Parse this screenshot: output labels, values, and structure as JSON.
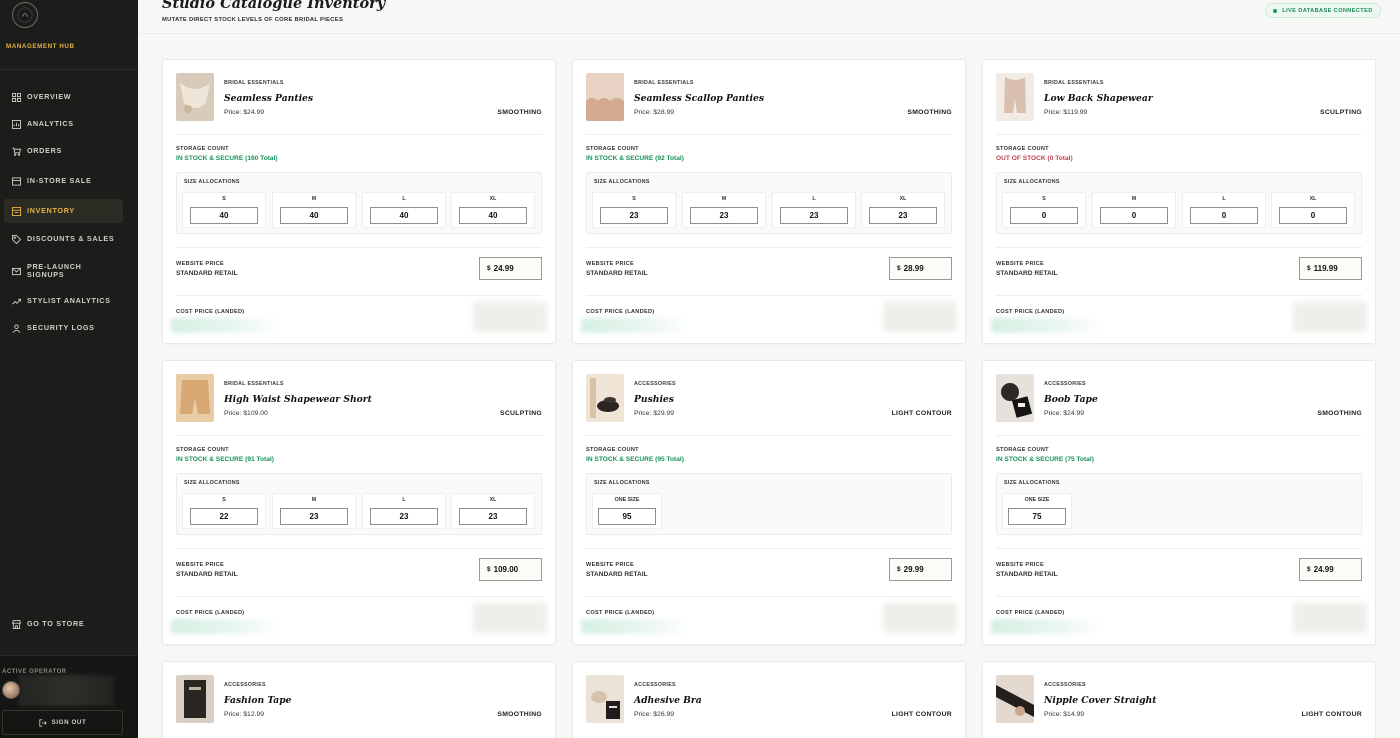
{
  "sidebar": {
    "hub_label": "MANAGEMENT HUB",
    "nav": [
      {
        "label": "OVERVIEW",
        "icon": "grid-icon"
      },
      {
        "label": "ANALYTICS",
        "icon": "chart-icon"
      },
      {
        "label": "ORDERS",
        "icon": "cart-icon"
      },
      {
        "label": "IN-STORE SALE",
        "icon": "register-icon"
      },
      {
        "label": "INVENTORY",
        "icon": "box-icon",
        "active": true
      },
      {
        "label": "DISCOUNTS & SALES",
        "icon": "tag-icon"
      },
      {
        "label": "PRE-LAUNCH SIGNUPS",
        "icon": "mail-icon"
      },
      {
        "label": "STYLIST ANALYTICS",
        "icon": "trend-icon"
      },
      {
        "label": "SECURITY LOGS",
        "icon": "shield-user-icon"
      }
    ],
    "go_to_store": "GO TO STORE",
    "operator_label": "ACTIVE OPERATOR",
    "sign_out": "SIGN OUT"
  },
  "header": {
    "title": "Studio Catalogue Inventory",
    "subtitle": "MUTATE DIRECT STOCK LEVELS OF CORE BRIDAL PIECES",
    "status": "LIVE DATABASE CONNECTED"
  },
  "labels": {
    "storage_count": "STORAGE COUNT",
    "size_allocations": "SIZE ALLOCATIONS",
    "website_price": "WEBSITE PRICE",
    "standard_retail": "STANDARD RETAIL",
    "cost_price": "COST PRICE (LANDED)",
    "currency": "$"
  },
  "colors": {
    "accent": "#e2b344",
    "in_stock": "#17925a",
    "out_of_stock": "#c0444f",
    "sidebar_bg": "#1c1c1a"
  },
  "products": [
    {
      "category": "BRIDAL ESSENTIALS",
      "name": "Seamless Panties",
      "price": "Price: $24.99",
      "tag": "SMOOTHING",
      "stock": "IN STOCK & SECURE (160 Total)",
      "in_stock": true,
      "sizes": [
        {
          "size": "S",
          "qty": "40"
        },
        {
          "size": "M",
          "qty": "40"
        },
        {
          "size": "L",
          "qty": "40"
        },
        {
          "size": "XL",
          "qty": "40"
        }
      ],
      "web_price": "24.99"
    },
    {
      "category": "BRIDAL ESSENTIALS",
      "name": "Seamless Scallop Panties",
      "price": "Price: $28.99",
      "tag": "SMOOTHING",
      "stock": "IN STOCK & SECURE (92 Total)",
      "in_stock": true,
      "sizes": [
        {
          "size": "S",
          "qty": "23"
        },
        {
          "size": "M",
          "qty": "23"
        },
        {
          "size": "L",
          "qty": "23"
        },
        {
          "size": "XL",
          "qty": "23"
        }
      ],
      "web_price": "28.99"
    },
    {
      "category": "BRIDAL ESSENTIALS",
      "name": "Low Back Shapewear",
      "price": "Price: $119.99",
      "tag": "SCULPTING",
      "stock": "OUT OF STOCK (0 Total)",
      "in_stock": false,
      "sizes": [
        {
          "size": "S",
          "qty": "0"
        },
        {
          "size": "M",
          "qty": "0"
        },
        {
          "size": "L",
          "qty": "0"
        },
        {
          "size": "XL",
          "qty": "0"
        }
      ],
      "web_price": "119.99"
    },
    {
      "category": "BRIDAL ESSENTIALS",
      "name": "High Waist Shapewear Short",
      "price": "Price: $109.00",
      "tag": "SCULPTING",
      "stock": "IN STOCK & SECURE (91 Total)",
      "in_stock": true,
      "sizes": [
        {
          "size": "S",
          "qty": "22"
        },
        {
          "size": "M",
          "qty": "23"
        },
        {
          "size": "L",
          "qty": "23"
        },
        {
          "size": "XL",
          "qty": "23"
        }
      ],
      "web_price": "109.00"
    },
    {
      "category": "ACCESSORIES",
      "name": "Pushies",
      "price": "Price: $29.99",
      "tag": "LIGHT CONTOUR",
      "stock": "IN STOCK & SECURE (95 Total)",
      "in_stock": true,
      "sizes": [
        {
          "size": "ONE SIZE",
          "qty": "95"
        }
      ],
      "web_price": "29.99"
    },
    {
      "category": "ACCESSORIES",
      "name": "Boob Tape",
      "price": "Price: $24.99",
      "tag": "SMOOTHING",
      "stock": "IN STOCK & SECURE (75 Total)",
      "in_stock": true,
      "sizes": [
        {
          "size": "ONE SIZE",
          "qty": "75"
        }
      ],
      "web_price": "24.99"
    },
    {
      "category": "ACCESSORIES",
      "name": "Fashion Tape",
      "price": "Price: $12.99",
      "tag": "SMOOTHING"
    },
    {
      "category": "ACCESSORIES",
      "name": "Adhesive Bra",
      "price": "Price: $26.99",
      "tag": "LIGHT CONTOUR"
    },
    {
      "category": "ACCESSORIES",
      "name": "Nipple Cover Straight",
      "price": "Price: $14.99",
      "tag": "LIGHT CONTOUR"
    }
  ]
}
